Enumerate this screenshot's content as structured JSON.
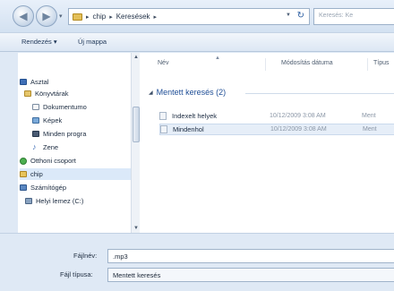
{
  "address": {
    "path_parts": [
      "chip",
      "Keresések"
    ],
    "search_placeholder": "Keresés: Ke"
  },
  "toolbar": {
    "organize": "Rendezés ▾",
    "new_folder": "Új mappa"
  },
  "nav": {
    "items": [
      {
        "label": "Asztal"
      },
      {
        "label": "Könyvtárak"
      },
      {
        "label": "Dokumentumo"
      },
      {
        "label": "Képek"
      },
      {
        "label": "Minden progra"
      },
      {
        "label": "Zene"
      },
      {
        "label": "Otthoni csoport"
      },
      {
        "label": "chip"
      },
      {
        "label": "Számítógép"
      },
      {
        "label": "Helyi lemez (C:)"
      }
    ]
  },
  "columns": {
    "name": "Név",
    "date": "Módosítás dátuma",
    "type": "Típus"
  },
  "group": {
    "label": "Mentett keresés (2)"
  },
  "files": [
    {
      "name": "Indexelt helyek",
      "date": "10/12/2009 3:08 AM",
      "type": "Ment"
    },
    {
      "name": "Mindenhol",
      "date": "10/12/2009 3:08 AM",
      "type": "Ment"
    }
  ],
  "form": {
    "filename_label": "Fájlnév:",
    "filename_value": ".mp3",
    "filetype_label": "Fájl típusa:",
    "filetype_value": "Mentett keresés"
  }
}
